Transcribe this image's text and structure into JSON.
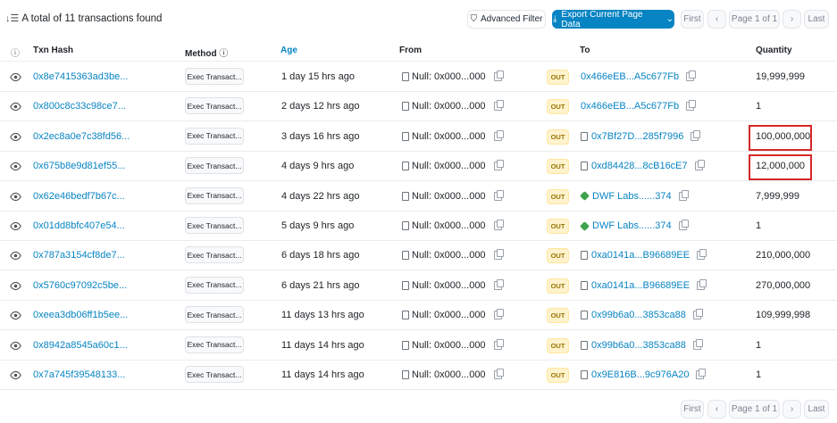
{
  "summary": {
    "sort_icon": "sort-down-icon",
    "text": "A total of 11 transactions found"
  },
  "toolbar": {
    "filter_label": "Advanced Filter",
    "export_label": "Export Current Page Data"
  },
  "pager": {
    "first": "First",
    "prev": "‹",
    "page": "Page 1 of 1",
    "next": "›",
    "last": "Last"
  },
  "columns": {
    "hash": "Txn Hash",
    "method": "Method",
    "age": "Age",
    "from": "From",
    "to": "To",
    "quantity": "Quantity"
  },
  "rows": [
    {
      "hash": "0x8e7415363ad3be...",
      "method": "Exec Transact...",
      "age": "1 day 15 hrs ago",
      "from": "Null: 0x000...000",
      "direction": "OUT",
      "to": "0x466eEB...A5c677Fb",
      "to_type": "contract",
      "quantity": "19,999,999"
    },
    {
      "hash": "0x800c8c33c98ce7...",
      "method": "Exec Transact...",
      "age": "2 days 12 hrs ago",
      "from": "Null: 0x000...000",
      "direction": "OUT",
      "to": "0x466eEB...A5c677Fb",
      "to_type": "contract",
      "quantity": "1"
    },
    {
      "hash": "0x2ec8a0e7c38fd56...",
      "method": "Exec Transact...",
      "age": "3 days 16 hrs ago",
      "from": "Null: 0x000...000",
      "direction": "OUT",
      "to": "0x7Bf27D...285f7996",
      "to_type": "file",
      "quantity": "100,000,000"
    },
    {
      "hash": "0x675b8e9d81ef55...",
      "method": "Exec Transact...",
      "age": "4 days 9 hrs ago",
      "from": "Null: 0x000...000",
      "direction": "OUT",
      "to": "0xd84428...8cB16cE7",
      "to_type": "file",
      "quantity": "12,000,000"
    },
    {
      "hash": "0x62e46bedf7b67c...",
      "method": "Exec Transact...",
      "age": "4 days 22 hrs ago",
      "from": "Null: 0x000...000",
      "direction": "OUT",
      "to": "DWF Labs......374",
      "to_type": "dwf",
      "quantity": "7,999,999"
    },
    {
      "hash": "0x01dd8bfc407e54...",
      "method": "Exec Transact...",
      "age": "5 days 9 hrs ago",
      "from": "Null: 0x000...000",
      "direction": "OUT",
      "to": "DWF Labs......374",
      "to_type": "dwf",
      "quantity": "1"
    },
    {
      "hash": "0x787a3154cf8de7...",
      "method": "Exec Transact...",
      "age": "6 days 18 hrs ago",
      "from": "Null: 0x000...000",
      "direction": "OUT",
      "to": "0xa0141a...B96689EE",
      "to_type": "file",
      "quantity": "210,000,000"
    },
    {
      "hash": "0x5760c97092c5be...",
      "method": "Exec Transact...",
      "age": "6 days 21 hrs ago",
      "from": "Null: 0x000...000",
      "direction": "OUT",
      "to": "0xa0141a...B96689EE",
      "to_type": "file",
      "quantity": "270,000,000"
    },
    {
      "hash": "0xeea3db06ff1b5ee...",
      "method": "Exec Transact...",
      "age": "11 days 13 hrs ago",
      "from": "Null: 0x000...000",
      "direction": "OUT",
      "to": "0x99b6a0...3853ca88",
      "to_type": "file",
      "quantity": "109,999,998"
    },
    {
      "hash": "0x8942a8545a60c1...",
      "method": "Exec Transact...",
      "age": "11 days 14 hrs ago",
      "from": "Null: 0x000...000",
      "direction": "OUT",
      "to": "0x99b6a0...3853ca88",
      "to_type": "file",
      "quantity": "1"
    },
    {
      "hash": "0x7a745f39548133...",
      "method": "Exec Transact...",
      "age": "11 days 14 hrs ago",
      "from": "Null: 0x000...000",
      "direction": "OUT",
      "to": "0x9E816B...9c976A20",
      "to_type": "file",
      "quantity": "1"
    }
  ],
  "highlighted_rows": [
    2,
    3
  ],
  "colors": {
    "link": "#0784c3",
    "export_bg": "#0784c3",
    "highlight": "#d62828",
    "out_badge": "#fff3cd"
  }
}
